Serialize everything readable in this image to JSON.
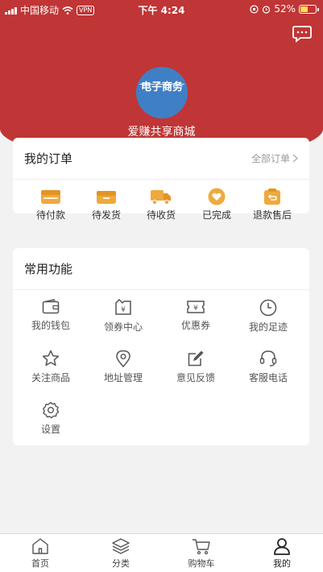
{
  "status_bar": {
    "carrier": "中国移动",
    "vpn": "VPN",
    "time": "下午 4:24",
    "battery": "52%",
    "battery_level": 0.52
  },
  "profile": {
    "avatar_text": "电子商务",
    "shop_name": "爱赚共享商城"
  },
  "orders": {
    "title": "我的订单",
    "all_label": "全部订单",
    "items": [
      {
        "label": "待付款",
        "icon": "wallet-icon"
      },
      {
        "label": "待发货",
        "icon": "box-icon"
      },
      {
        "label": "待收货",
        "icon": "truck-icon"
      },
      {
        "label": "已完成",
        "icon": "heart-icon"
      },
      {
        "label": "退款售后",
        "icon": "refund-icon"
      }
    ],
    "icon_color": "#f0a93c"
  },
  "functions": {
    "title": "常用功能",
    "items": [
      {
        "label": "我的钱包",
        "icon": "wallet-outline-icon"
      },
      {
        "label": "领券中心",
        "icon": "coupon-center-icon"
      },
      {
        "label": "优惠券",
        "icon": "ticket-icon"
      },
      {
        "label": "我的足迹",
        "icon": "clock-icon"
      },
      {
        "label": "关注商品",
        "icon": "star-icon"
      },
      {
        "label": "地址管理",
        "icon": "location-icon"
      },
      {
        "label": "意见反馈",
        "icon": "edit-icon"
      },
      {
        "label": "客服电话",
        "icon": "headset-icon"
      },
      {
        "label": "设置",
        "icon": "gear-icon"
      }
    ]
  },
  "tabbar": {
    "items": [
      {
        "label": "首页",
        "icon": "home-icon"
      },
      {
        "label": "分类",
        "icon": "layers-icon"
      },
      {
        "label": "购物车",
        "icon": "cart-icon"
      },
      {
        "label": "我的",
        "icon": "user-icon"
      }
    ],
    "active_index": 3
  },
  "colors": {
    "brand": "#c03535",
    "accent": "#f0a93c"
  }
}
